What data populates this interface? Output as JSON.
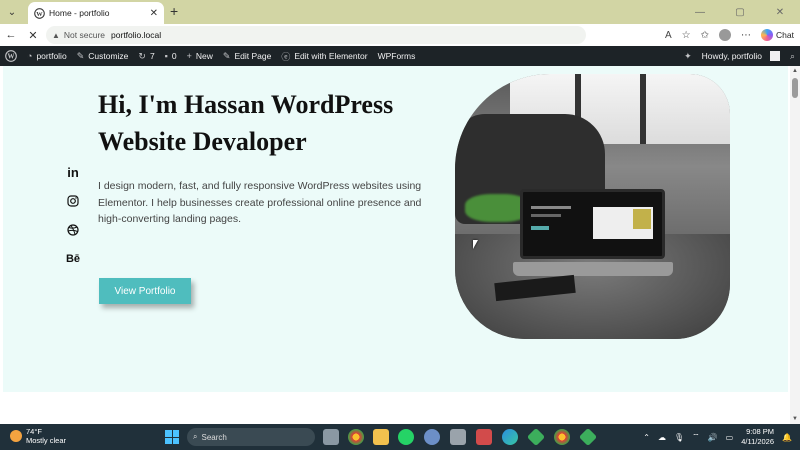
{
  "browser": {
    "tab_title": "Home - portfolio",
    "tab_close": "✕",
    "new_tab": "+",
    "menu_glyph": "⌄",
    "not_secure": "Not secure",
    "url": "portfolio.local",
    "chat_label": "Chat",
    "window_controls": [
      "—",
      "▢",
      "✕"
    ]
  },
  "wp_admin_bar": {
    "site_name": "portfolio",
    "customize": "Customize",
    "updates_count": "7",
    "comments_count": "0",
    "new": "New",
    "edit_page": "Edit Page",
    "edit_elementor": "Edit with Elementor",
    "wpforms": "WPForms",
    "howdy": "Howdy, portfolio"
  },
  "hero": {
    "headline": "Hi, I'm Hassan WordPress Website Devaloper",
    "description": "I design modern, fast, and fully responsive WordPress websites using Elementor. I help businesses create professional online presence and high-converting landing pages.",
    "cta_label": "View Portfolio",
    "social": [
      "in",
      "◎",
      "◍",
      "Bē"
    ]
  },
  "taskbar": {
    "temperature": "74°F",
    "weather": "Mostly clear",
    "search_placeholder": "Search",
    "time": "9:08 PM",
    "date": "4/11/2026"
  }
}
